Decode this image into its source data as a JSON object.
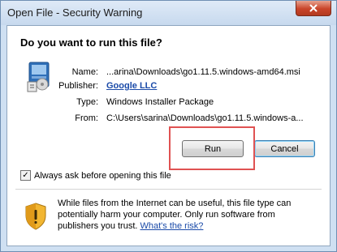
{
  "window": {
    "title": "Open File - Security Warning",
    "close_glyph": "x"
  },
  "dialog": {
    "question": "Do you want to run this file?",
    "fields": {
      "name_label": "Name:",
      "name_value": "...arina\\Downloads\\go1.11.5.windows-amd64.msi",
      "publisher_label": "Publisher:",
      "publisher_value": "Google LLC",
      "type_label": "Type:",
      "type_value": "Windows Installer Package",
      "from_label": "From:",
      "from_value": "C:\\Users\\sarina\\Downloads\\go1.11.5.windows-a..."
    },
    "buttons": {
      "run_label": "Run",
      "cancel_label": "Cancel"
    },
    "checkbox": {
      "label": "Always ask before opening this file",
      "checked": true,
      "check_glyph": "✓"
    },
    "warning": {
      "text": "While files from the Internet can be useful, this file type can potentially harm your computer. Only run software from publishers you trust. ",
      "link_text": "What's the risk?"
    }
  },
  "icons": {
    "close": "close-icon",
    "package": "installer-package-icon",
    "shield": "security-shield-icon"
  },
  "colors": {
    "title_bar": "#cfe0f2",
    "link": "#1a4aa8",
    "highlight": "#e05252",
    "close_button": "#c9452a"
  }
}
